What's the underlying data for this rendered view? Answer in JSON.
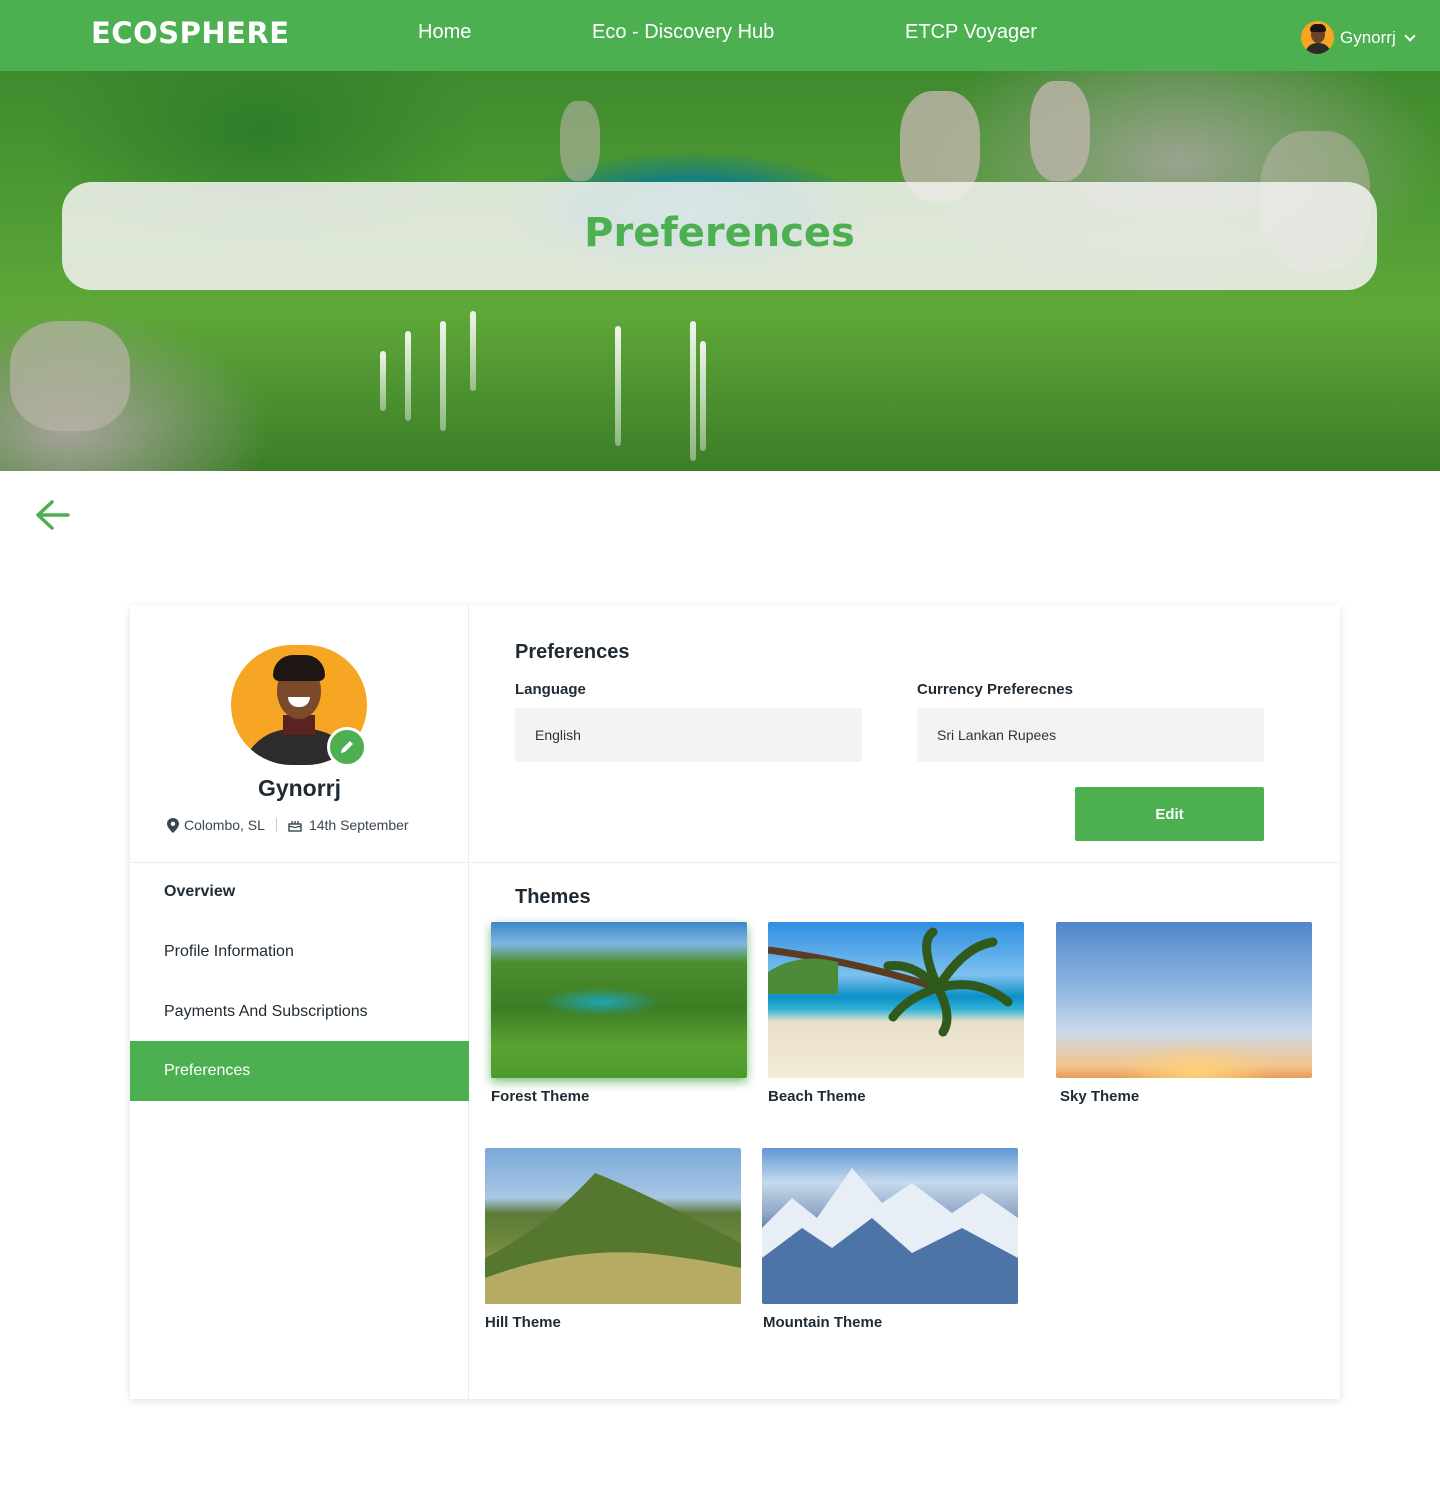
{
  "nav": {
    "brand": "ECOSPHERE",
    "links": [
      "Home",
      "Eco - Discovery Hub",
      "ETCP Voyager"
    ],
    "user_name": "Gynorrj"
  },
  "hero": {
    "title": "Preferences"
  },
  "profile": {
    "name": "Gynorrj",
    "location": "Colombo, SL",
    "birthday": "14th September"
  },
  "sidebar": {
    "items": [
      {
        "label": "Overview"
      },
      {
        "label": "Profile Information"
      },
      {
        "label": "Payments And Subscriptions"
      },
      {
        "label": "Preferences",
        "active": true
      }
    ]
  },
  "preferences": {
    "title": "Preferences",
    "language_label": "Language",
    "language_value": "English",
    "currency_label": "Currency Preferecnes",
    "currency_value": "Sri Lankan Rupees",
    "edit_label": "Edit"
  },
  "themes": {
    "title": "Themes",
    "items": [
      {
        "label": "Forest Theme",
        "selected": true
      },
      {
        "label": "Beach Theme"
      },
      {
        "label": "Sky Theme"
      },
      {
        "label": "Hill Theme"
      },
      {
        "label": "Mountain Theme"
      }
    ]
  },
  "colors": {
    "accent": "#4caf50",
    "text": "#1f2a33",
    "field_bg": "#f3f3f3"
  },
  "icons": [
    "avatar",
    "chevron-down-icon",
    "back-arrow-icon",
    "pencil-icon",
    "location-pin-icon",
    "birthday-cake-icon"
  ]
}
